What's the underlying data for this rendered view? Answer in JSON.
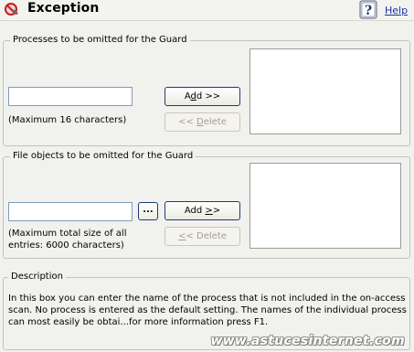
{
  "header": {
    "title": "Exception",
    "help_label": "Help"
  },
  "processes_group": {
    "legend": "Processes to be omitted for the Guard",
    "input_value": "",
    "add_label_pre": "A",
    "add_label_underlined": "d",
    "add_label_post": "d >>",
    "delete_label_pre": "<< ",
    "delete_label_underlined": "D",
    "delete_label_post": "elete",
    "hint": "(Maximum 16 characters)"
  },
  "files_group": {
    "legend": "File objects to be omitted for the Guard",
    "input_value": "",
    "browse_label": "...",
    "add_label_pre": "Add ",
    "add_label_underlined": ">",
    "add_label_post": ">",
    "delete_label_pre": "",
    "delete_label_underlined": "<",
    "delete_label_post": "< Delete",
    "hint_line1": "(Maximum total size of all",
    "hint_line2": "entries: 6000 characters)"
  },
  "description": {
    "legend": "Description",
    "line1": "In this box you can enter the name of the process that is not included in the on-access",
    "line2": "scan. No process is entered as the default setting. The names of the individual process",
    "line3": "can most easily be obtai...for more information press F1."
  },
  "watermark": "www.astucesinternet.com"
}
